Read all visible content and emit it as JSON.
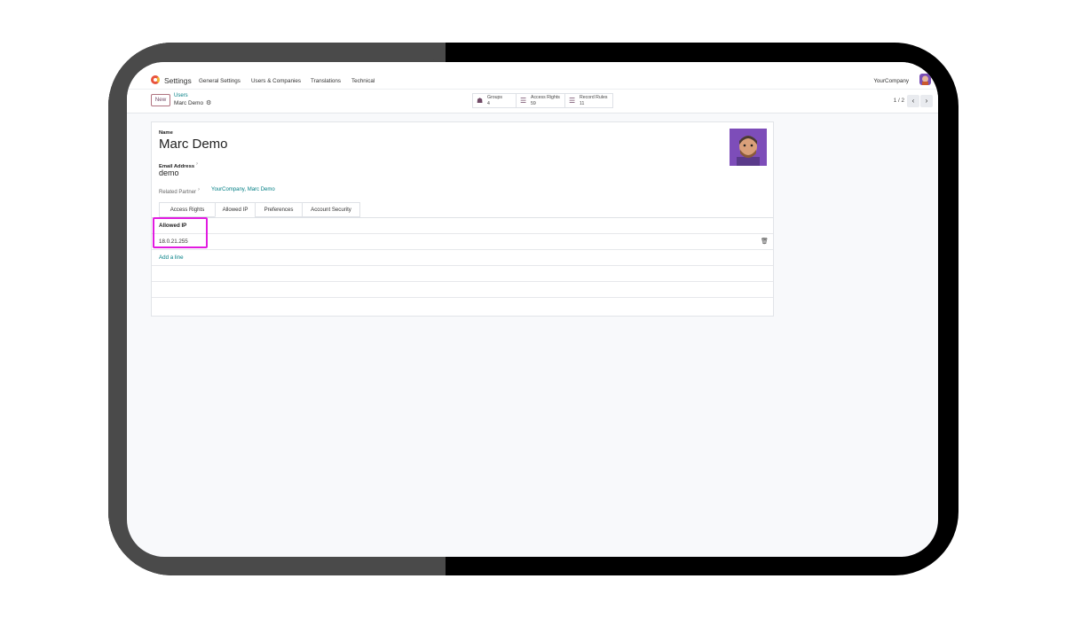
{
  "topnav": {
    "app_name": "Settings",
    "menu": [
      "General Settings",
      "Users & Companies",
      "Translations",
      "Technical"
    ],
    "company": "YourCompany"
  },
  "control_panel": {
    "new_label": "New",
    "breadcrumb_parent": "Users",
    "breadcrumb_current": "Marc Demo",
    "stats": [
      {
        "label": "Groups",
        "value": "4",
        "icon": "users-icon"
      },
      {
        "label": "Access Rights",
        "value": "59",
        "icon": "list-icon"
      },
      {
        "label": "Record Rules",
        "value": "11",
        "icon": "list-icon"
      }
    ],
    "pager": "1 / 2"
  },
  "form": {
    "name_label": "Name",
    "name_value": "Marc Demo",
    "email_label": "Email Address",
    "email_tooltip": "?",
    "email_value": "demo",
    "partner_label": "Related Partner",
    "partner_tooltip": "?",
    "partner_value": "YourCompany, Marc Demo",
    "tabs": [
      "Access Rights",
      "Allowed IP",
      "Preferences",
      "Account Security"
    ],
    "active_tab": "Allowed IP",
    "list_header": "Allowed IP",
    "rows": [
      "18.0.21.255"
    ],
    "add_line": "Add a line"
  },
  "colors": {
    "brand": "#714b67",
    "link": "#017e84",
    "highlight": "#e11be0"
  }
}
